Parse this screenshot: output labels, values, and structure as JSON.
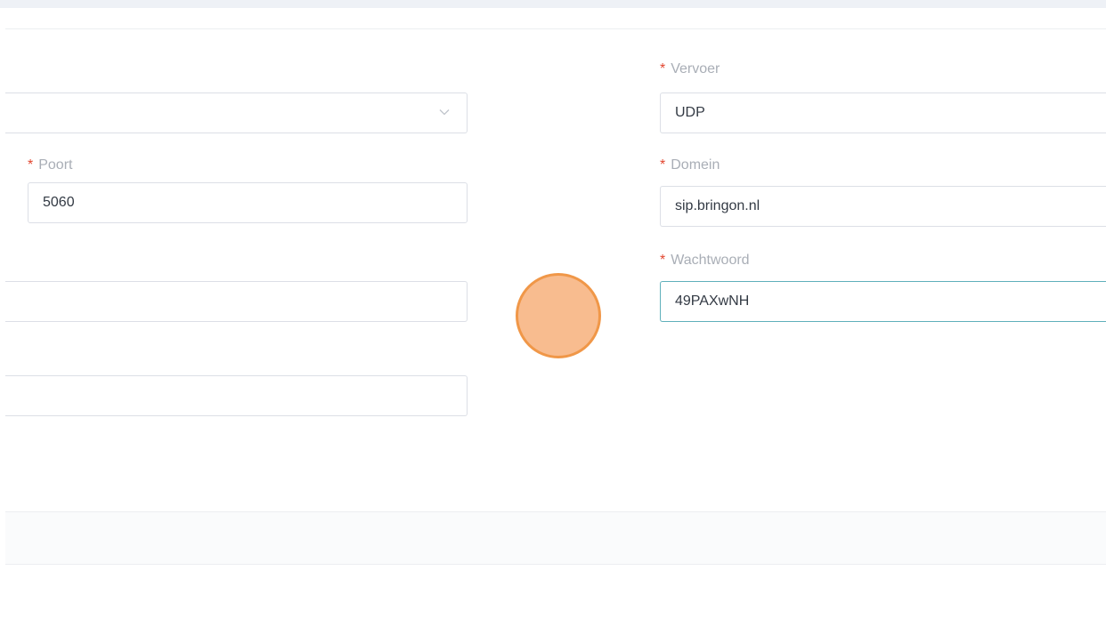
{
  "form": {
    "required_mark": "*",
    "left": {
      "select_value": "",
      "poort_label": "Poort",
      "poort_value": "5060",
      "field3_value": "",
      "field4_value": ""
    },
    "right": {
      "vervoer_label": "Vervoer",
      "vervoer_value": "UDP",
      "domein_label": "Domein",
      "domein_value": "sip.bringon.nl",
      "wachtwoord_label": "Wachtwoord",
      "wachtwoord_value": "49PAXwNH"
    }
  },
  "colors": {
    "required": "#e2462f",
    "focus_border": "#5fb0bb",
    "cursor_fill": "#f8b98a",
    "cursor_border": "#f0923f"
  },
  "icons": {
    "select_arrow": "chevron-down-icon"
  }
}
